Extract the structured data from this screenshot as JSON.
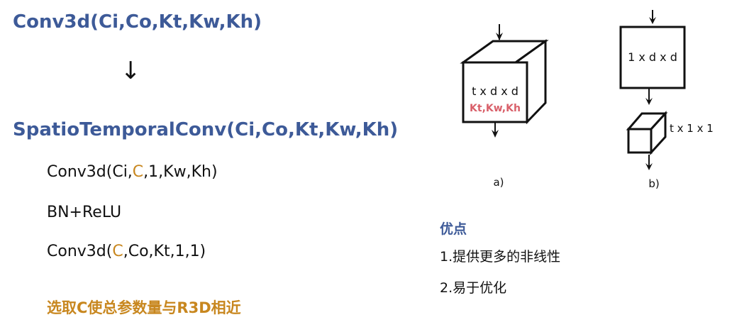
{
  "left": {
    "title_conv3d": "Conv3d(Ci,Co,Kt,Kw,Kh)",
    "arrow": "↓",
    "title_st": "SpatioTemporalConv(Ci,Co,Kt,Kw,Kh)",
    "line1": {
      "pre": "Conv3d(Ci,",
      "hl": "C",
      "post": ",1,Kw,Kh)"
    },
    "line2": "BN+ReLU",
    "line3": {
      "pre": "Conv3d(",
      "hl": "C",
      "post": ",Co,Kt,1,1)"
    },
    "note": "选取C使总参数量与R3D相近"
  },
  "diagram": {
    "a_box_label": "t x d x d",
    "a_kernel_label": "Kt,Kw,Kh",
    "a_caption": "a)",
    "b_box_label": "1 x d x d",
    "b_small_label": "t x 1 x 1",
    "b_caption": "b)"
  },
  "advantages": {
    "title": "优点",
    "items": [
      "1.提供更多的非线性",
      "2.易于优化"
    ]
  },
  "colors": {
    "title_blue": "#3d5a98",
    "highlight_orange": "#c8871f",
    "kernel_red": "#d9606a"
  }
}
